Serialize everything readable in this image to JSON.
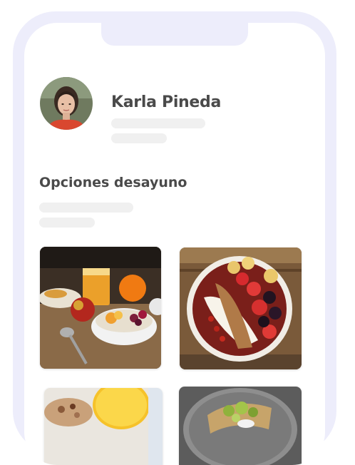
{
  "profile": {
    "name": "Karla Pineda"
  },
  "section": {
    "title": "Opciones desayuno"
  },
  "meals": [
    {
      "icon": "breakfast-table-photo"
    },
    {
      "icon": "acai-bowl-photo"
    },
    {
      "icon": "granola-juice-photo"
    },
    {
      "icon": "avocado-toast-photo"
    }
  ],
  "colors": {
    "frame": "#ededfb",
    "text": "#4a4a4a",
    "skeleton": "#f0f0f0"
  }
}
